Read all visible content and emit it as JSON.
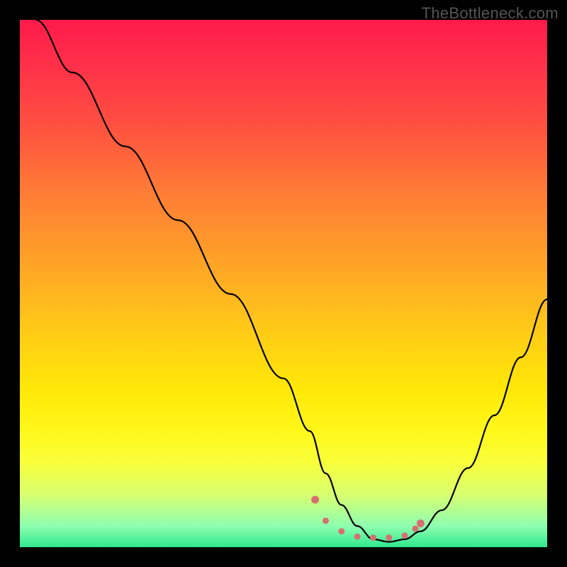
{
  "watermark": "TheBottleneck.com",
  "chart_data": {
    "type": "line",
    "title": "",
    "xlabel": "",
    "ylabel": "",
    "xlim": [
      0,
      100
    ],
    "ylim": [
      0,
      100
    ],
    "series": [
      {
        "name": "curve",
        "x": [
          3,
          10,
          20,
          30,
          40,
          50,
          55,
          58,
          61,
          64,
          67,
          70,
          73,
          76,
          80,
          85,
          90,
          95,
          100
        ],
        "y": [
          100,
          90,
          76,
          62,
          48,
          32,
          22,
          14,
          8,
          4,
          1.5,
          1,
          1.5,
          3,
          7,
          15,
          25,
          36,
          47
        ]
      }
    ],
    "highlight_dots": {
      "x": [
        56,
        58,
        61,
        64,
        67,
        70,
        73,
        75,
        76
      ],
      "y": [
        9,
        5,
        3,
        2,
        1.8,
        1.8,
        2.2,
        3.5,
        4.5
      ]
    }
  }
}
